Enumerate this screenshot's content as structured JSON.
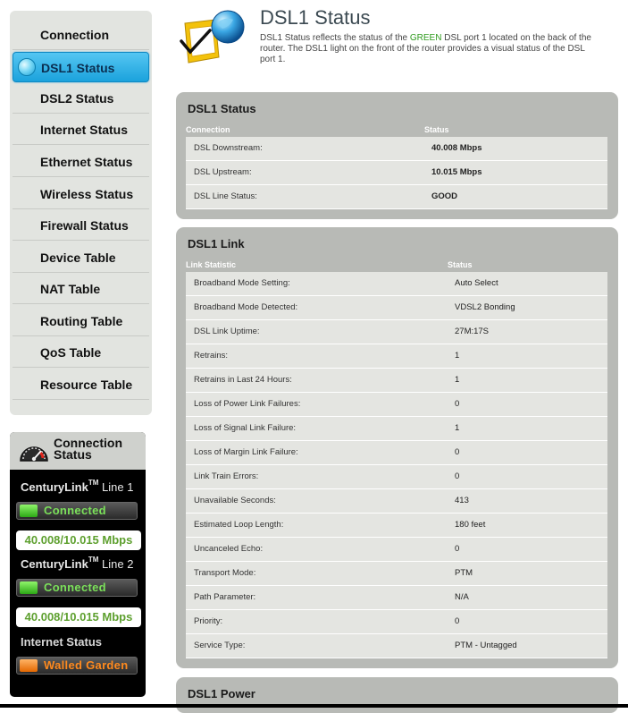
{
  "sidebar": {
    "items": [
      {
        "label": "Connection Status"
      },
      {
        "label": "DSL1 Status"
      },
      {
        "label": "DSL2 Status"
      },
      {
        "label": "Internet Status"
      },
      {
        "label": "Ethernet Status"
      },
      {
        "label": "Wireless Status"
      },
      {
        "label": "Firewall Status"
      },
      {
        "label": "Device Table"
      },
      {
        "label": "NAT Table"
      },
      {
        "label": "Routing Table"
      },
      {
        "label": "QoS Table"
      },
      {
        "label": "Resource Table"
      }
    ],
    "active_index": 1
  },
  "widget": {
    "title_line1": "Connection",
    "title_line2": "Status",
    "line1_brand": "CenturyLink",
    "line1_tm": "TM",
    "line1_name": "Line 1",
    "line1_state": "Connected",
    "line1_speed": "40.008/10.015 Mbps",
    "line2_brand": "CenturyLink",
    "line2_tm": "TM",
    "line2_name": "Line 2",
    "line2_state": "Connected",
    "line2_speed": "40.008/10.015 Mbps",
    "internet_label": "Internet Status",
    "internet_state": "Walled Garden"
  },
  "header": {
    "title": "DSL1 Status",
    "desc_part1": "DSL1 Status reflects the status of the ",
    "desc_green": "GREEN",
    "desc_part2": " DSL port 1 located on the back of the router. The DSL1 light on the front of the router provides a visual status of the DSL port 1."
  },
  "status_panel": {
    "title": "DSL1 Status",
    "col1": "Connection",
    "col2": "Status",
    "rows": [
      {
        "k": "DSL Downstream:",
        "v": "40.008 Mbps"
      },
      {
        "k": "DSL Upstream:",
        "v": "10.015 Mbps"
      },
      {
        "k": "DSL Line Status:",
        "v": "GOOD"
      }
    ]
  },
  "link_panel": {
    "title": "DSL1 Link",
    "col1": "Link Statistic",
    "col2": "Status",
    "rows": [
      {
        "k": "Broadband Mode Setting:",
        "v": "Auto Select"
      },
      {
        "k": "Broadband Mode Detected:",
        "v": "VDSL2 Bonding"
      },
      {
        "k": "DSL Link Uptime:",
        "v": "27M:17S"
      },
      {
        "k": "Retrains:",
        "v": "1"
      },
      {
        "k": "Retrains in Last 24 Hours:",
        "v": "1"
      },
      {
        "k": "Loss of Power Link Failures:",
        "v": "0"
      },
      {
        "k": "Loss of Signal Link Failure:",
        "v": "1"
      },
      {
        "k": "Loss of Margin Link Failure:",
        "v": "0"
      },
      {
        "k": "Link Train Errors:",
        "v": "0"
      },
      {
        "k": "Unavailable Seconds:",
        "v": "413"
      },
      {
        "k": "Estimated Loop Length:",
        "v": "180 feet"
      },
      {
        "k": "Uncanceled Echo:",
        "v": "0"
      },
      {
        "k": "Transport Mode:",
        "v": "PTM"
      },
      {
        "k": "Path Parameter:",
        "v": "N/A"
      },
      {
        "k": "Priority:",
        "v": "0"
      },
      {
        "k": "Service Type:",
        "v": "PTM - Untagged"
      }
    ]
  },
  "power_panel": {
    "title": "DSL1 Power"
  }
}
